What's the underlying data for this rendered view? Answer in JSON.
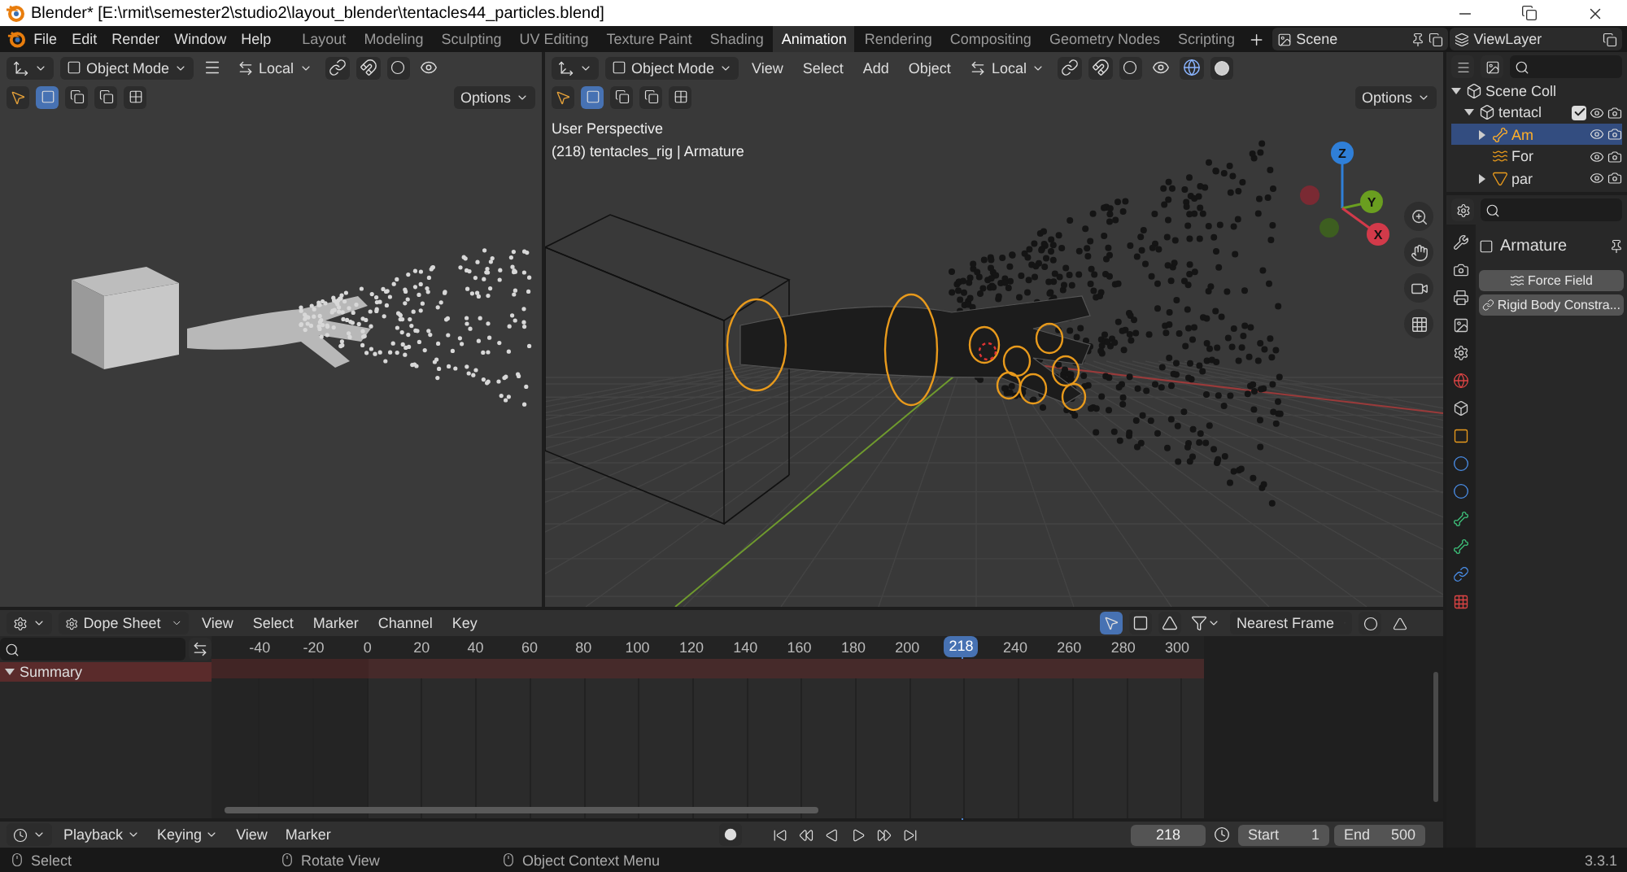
{
  "title_bar": {
    "title": "Blender* [E:\\rmit\\semester2\\studio2\\layout_blender\\tentacles44_particles.blend]"
  },
  "top_bar": {
    "menus": [
      "File",
      "Edit",
      "Render",
      "Window",
      "Help"
    ],
    "workspaces": [
      {
        "label": "Layout",
        "selected": false
      },
      {
        "label": "Modeling",
        "selected": false
      },
      {
        "label": "Sculpting",
        "selected": false
      },
      {
        "label": "UV Editing",
        "selected": false
      },
      {
        "label": "Texture Paint",
        "selected": false
      },
      {
        "label": "Shading",
        "selected": false
      },
      {
        "label": "Animation",
        "selected": true
      },
      {
        "label": "Rendering",
        "selected": false
      },
      {
        "label": "Compositing",
        "selected": false
      },
      {
        "label": "Geometry Nodes",
        "selected": false
      },
      {
        "label": "Scripting",
        "selected": false
      }
    ],
    "scene": "Scene",
    "view_layer": "ViewLayer"
  },
  "left_viewport": {
    "mode": "Object Mode",
    "orientation": "Local",
    "options": "Options"
  },
  "main_viewport": {
    "mode": "Object Mode",
    "menus": [
      "View",
      "Select",
      "Add",
      "Object"
    ],
    "orientation": "Local",
    "options": "Options",
    "info": [
      "User Perspective",
      "(218) tentacles_rig | Armature"
    ],
    "axes": [
      "Z",
      "Y",
      "X"
    ]
  },
  "outliner": {
    "tree": [
      {
        "label": "Scene Coll",
        "expanded": true,
        "children": [
          {
            "label": "tentacl",
            "expanded": true,
            "checked": true,
            "children": [
              {
                "label": "Am",
                "kind": "armature",
                "selected": true,
                "expanded": false
              },
              {
                "label": "For",
                "kind": "force",
                "selected": false
              },
              {
                "label": "par",
                "kind": "particles",
                "selected": false,
                "expanded": false
              }
            ]
          }
        ]
      }
    ]
  },
  "properties": {
    "object": "Armature",
    "buttons": [
      {
        "label": "Force Field",
        "kind": "force"
      },
      {
        "label": "Rigid Body Constra...",
        "kind": "rigid"
      }
    ]
  },
  "dope_sheet": {
    "editor": "Dope Sheet",
    "menus": [
      "View",
      "Select",
      "Marker",
      "Channel",
      "Key"
    ],
    "snapping": "Nearest Frame",
    "ruler_before": [
      "-40",
      "-20",
      "0",
      "20",
      "40",
      "60",
      "80",
      "100",
      "120",
      "140",
      "160",
      "180",
      "200"
    ],
    "current_frame": "218",
    "ruler_after": [
      "240",
      "260",
      "280",
      "300"
    ],
    "channels": [
      {
        "label": "Summary",
        "expanded": true
      }
    ]
  },
  "timeline": {
    "menus": [
      {
        "label": "Playback",
        "kind": "dropdown"
      },
      {
        "label": "Keying",
        "kind": "dropdown"
      },
      {
        "label": "View",
        "kind": "menu"
      },
      {
        "label": "Marker",
        "kind": "menu"
      }
    ],
    "current_frame": "218",
    "start": {
      "label": "Start",
      "value": "1"
    },
    "end": {
      "label": "End",
      "value": "500"
    }
  },
  "status_bar": {
    "hints": [
      "Select",
      "Rotate View",
      "Object Context Menu"
    ],
    "version": "3.3.1"
  }
}
